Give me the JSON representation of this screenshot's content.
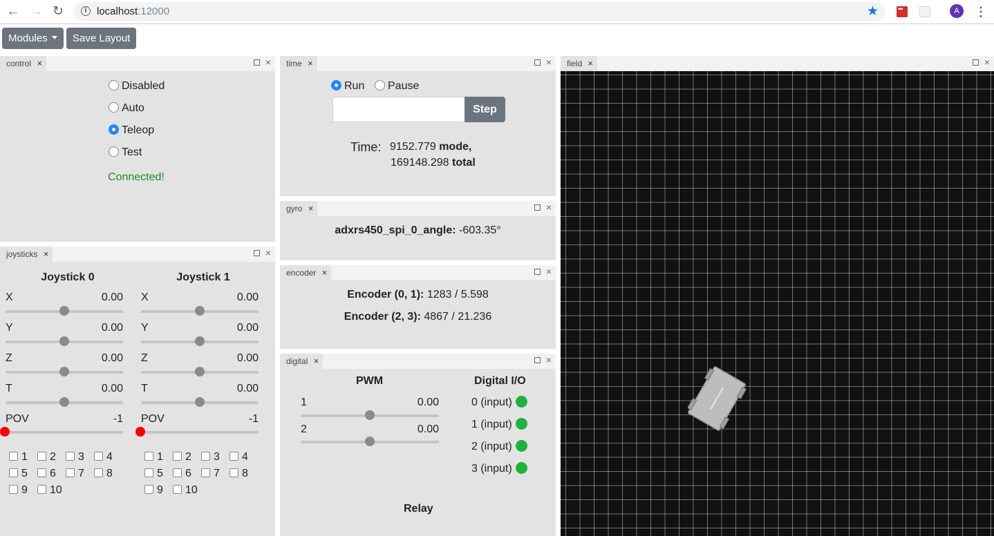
{
  "browser": {
    "url_host": "localhost",
    "url_port": ":12000",
    "avatar_letter": "A"
  },
  "toolbar": {
    "modules_label": "Modules",
    "save_layout_label": "Save Layout"
  },
  "panels": {
    "control": {
      "tab": "control",
      "modes": [
        {
          "label": "Disabled",
          "checked": false
        },
        {
          "label": "Auto",
          "checked": false
        },
        {
          "label": "Teleop",
          "checked": true
        },
        {
          "label": "Test",
          "checked": false
        }
      ],
      "status": "Connected!"
    },
    "time": {
      "tab": "time",
      "run_label": "Run",
      "pause_label": "Pause",
      "run_checked": true,
      "step_label": "Step",
      "input_value": "",
      "time_label": "Time:",
      "mode_time": "9152.779",
      "mode_word": "mode,",
      "total_time": "169148.298",
      "total_word": "total"
    },
    "gyro": {
      "tab": "gyro",
      "name": "adxrs450_spi_0_angle:",
      "value": "-603.35°"
    },
    "encoder": {
      "tab": "encoder",
      "rows": [
        {
          "name": "Encoder (0, 1):",
          "value": "1283 / 5.598"
        },
        {
          "name": "Encoder (2, 3):",
          "value": "4867 / 21.236"
        }
      ]
    },
    "digital": {
      "tab": "digital",
      "pwm_title": "PWM",
      "pwm": [
        {
          "label": "1",
          "value": "0.00",
          "fraction": 0.5
        },
        {
          "label": "2",
          "value": "0.00",
          "fraction": 0.5
        }
      ],
      "dio_title": "Digital I/O",
      "dio": [
        "0 (input)",
        "1 (input)",
        "2 (input)",
        "3 (input)"
      ],
      "relay_title": "Relay",
      "led_color": "#1db33a"
    },
    "joysticks": {
      "tab": "joysticks",
      "sticks": [
        {
          "title": "Joystick 0",
          "axes": [
            {
              "label": "X",
              "value": "0.00"
            },
            {
              "label": "Y",
              "value": "0.00"
            },
            {
              "label": "Z",
              "value": "0.00"
            },
            {
              "label": "T",
              "value": "0.00"
            }
          ],
          "pov_label": "POV",
          "pov_value": "-1",
          "buttons": [
            "1",
            "2",
            "3",
            "4",
            "5",
            "6",
            "7",
            "8",
            "9",
            "10"
          ]
        },
        {
          "title": "Joystick 1",
          "axes": [
            {
              "label": "X",
              "value": "0.00"
            },
            {
              "label": "Y",
              "value": "0.00"
            },
            {
              "label": "Z",
              "value": "0.00"
            },
            {
              "label": "T",
              "value": "0.00"
            }
          ],
          "pov_label": "POV",
          "pov_value": "-1",
          "buttons": [
            "1",
            "2",
            "3",
            "4",
            "5",
            "6",
            "7",
            "8",
            "9",
            "10"
          ]
        }
      ]
    },
    "field": {
      "tab": "field"
    }
  },
  "colors": {
    "accent": "#2684ff",
    "status_ok": "#1f8a1f",
    "pov_thumb": "#ff0000"
  }
}
